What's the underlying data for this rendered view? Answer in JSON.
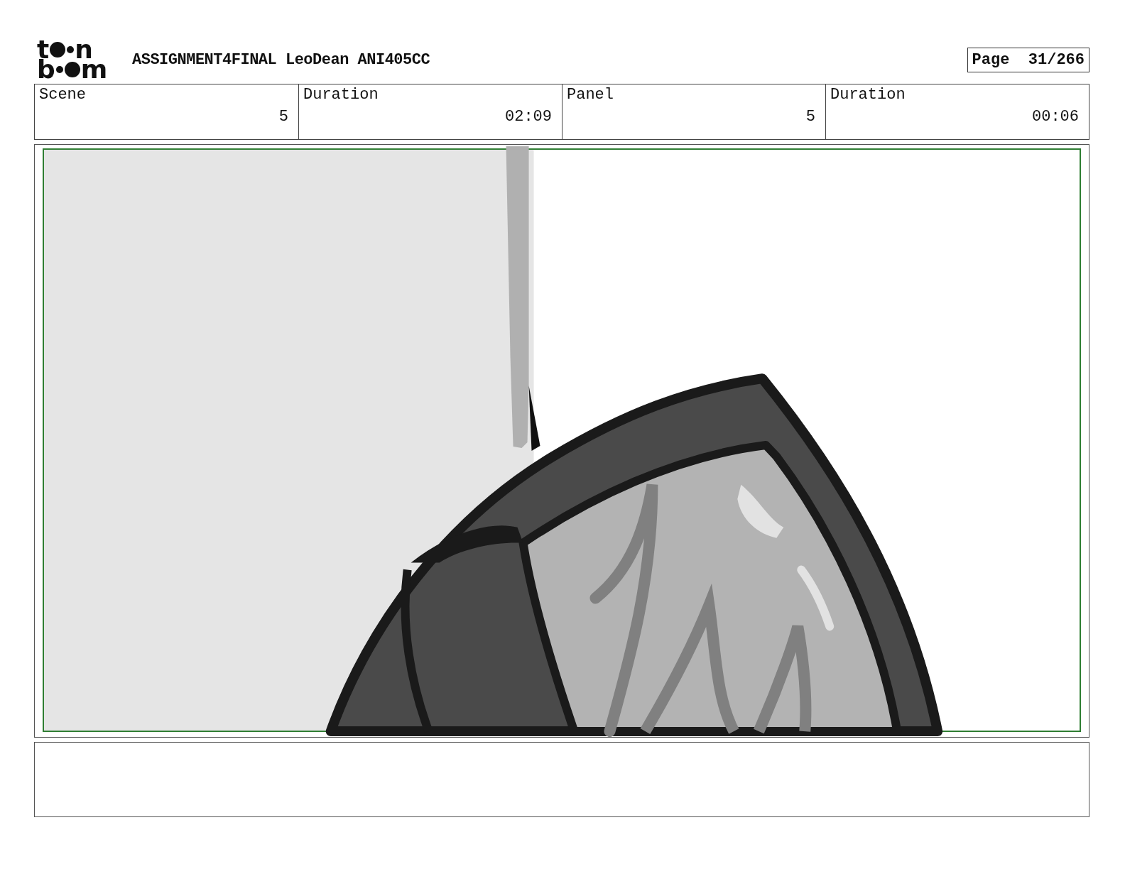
{
  "logo": {
    "top_start": "t",
    "top_end": "n",
    "bottom_start": "b",
    "bottom_end": "m"
  },
  "title": "ASSIGNMENT4FINAL LeoDean ANI405CC",
  "page": {
    "label": "Page",
    "number": "31/266"
  },
  "fields": [
    {
      "label": "Scene",
      "value": "5"
    },
    {
      "label": "Duration",
      "value": "02:09"
    },
    {
      "label": "Panel",
      "value": "5"
    },
    {
      "label": "Duration",
      "value": "00:06"
    }
  ]
}
